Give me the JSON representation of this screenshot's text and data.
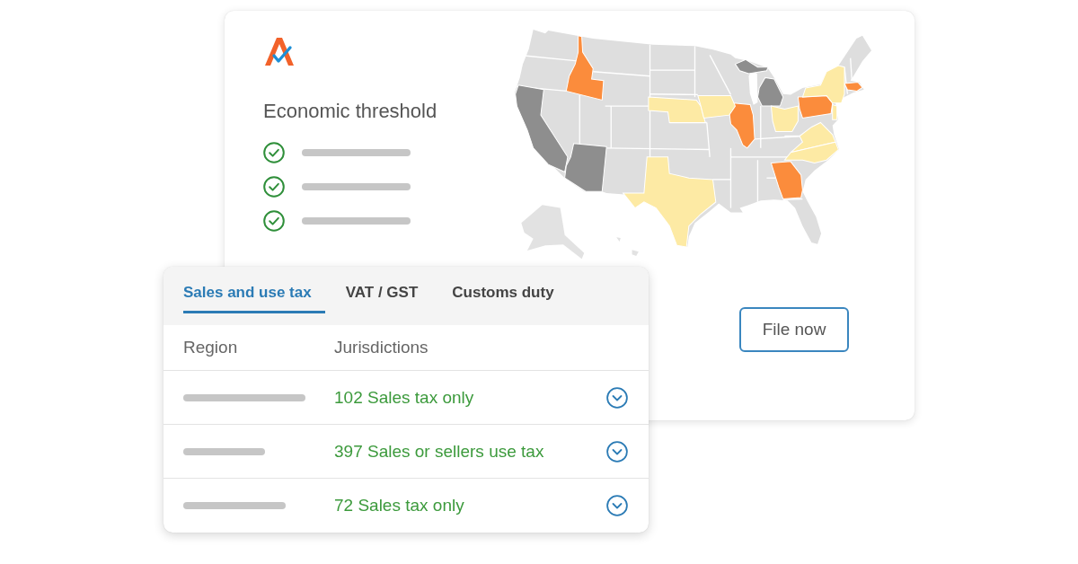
{
  "overview_card": {
    "title": "Economic threshold",
    "checklist": [
      {
        "checked": true
      },
      {
        "checked": true
      },
      {
        "checked": true
      }
    ],
    "file_button": "File now"
  },
  "tax_table": {
    "tabs": [
      {
        "label": "Sales and use tax",
        "selected": true
      },
      {
        "label": "VAT / GST",
        "selected": false
      },
      {
        "label": "Customs duty",
        "selected": false
      }
    ],
    "columns": [
      "Region",
      "Jurisdictions"
    ],
    "rows": [
      {
        "jurisdictions": "102 Sales tax only",
        "expanded": false
      },
      {
        "jurisdictions": "397 Sales or sellers use tax",
        "expanded": false
      },
      {
        "jurisdictions": "72 Sales tax only",
        "expanded": false
      }
    ]
  }
}
